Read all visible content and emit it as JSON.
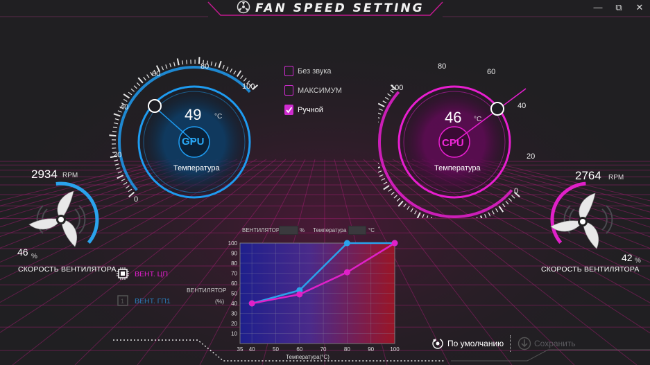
{
  "window": {
    "title": "FAN SPEED SETTING",
    "minimize": "—",
    "maximize": "⧉",
    "close": "✕"
  },
  "gpu": {
    "temp": "49",
    "temp_unit": "°C",
    "name": "GPU",
    "caption": "Температура",
    "ticks": [
      "0",
      "20",
      "40",
      "60",
      "80",
      "100"
    ],
    "temp_value": 49
  },
  "cpu": {
    "temp": "46",
    "temp_unit": "°C",
    "name": "CPU",
    "caption": "Температура",
    "ticks": [
      "0",
      "20",
      "40",
      "60",
      "80",
      "100"
    ],
    "temp_value": 46
  },
  "options": [
    {
      "label": "Без звука",
      "checked": false
    },
    {
      "label": "МАКСИМУМ",
      "checked": false
    },
    {
      "label": "Ручной",
      "checked": true
    }
  ],
  "fan_left": {
    "rpm": "2934",
    "rpm_unit": "RPM",
    "percent": "46",
    "percent_unit": "%",
    "caption": "СКОРОСТЬ ВЕНТИЛЯТОРА",
    "level": 0.46
  },
  "fan_right": {
    "rpm": "2764",
    "rpm_unit": "RPM",
    "percent": "42",
    "percent_unit": "%",
    "caption": "СКОРОСТЬ ВЕНТИЛЯТОРА",
    "level": 0.42
  },
  "selectors": [
    {
      "label": "ВЕНТ. ЦП",
      "active": true
    },
    {
      "label": "ВЕНТ. ГП1",
      "active": false
    }
  ],
  "chart_header": {
    "fan_label": "ВЕНТИЛЯТОР",
    "fan_unit": "%",
    "temp_label": "Температура",
    "temp_unit": "°C"
  },
  "chart_data": {
    "type": "line",
    "ylabel_line1": "ВЕНТИЛЯТОР",
    "ylabel_line2": "(%)",
    "xlabel": "Температура(°C)",
    "x_ticks": [
      "35",
      "40",
      "50",
      "60",
      "70",
      "80",
      "90",
      "100"
    ],
    "y_ticks": [
      "10",
      "20",
      "30",
      "40",
      "50",
      "60",
      "70",
      "80",
      "90",
      "100"
    ],
    "xlim": [
      35,
      100
    ],
    "ylim": [
      0,
      100
    ],
    "series": [
      {
        "color": "#2aa3ec",
        "points": [
          [
            40,
            40
          ],
          [
            60,
            53
          ],
          [
            80,
            100
          ],
          [
            100,
            100
          ]
        ]
      },
      {
        "color": "#e020c8",
        "points": [
          [
            40,
            40
          ],
          [
            60,
            49
          ],
          [
            80,
            71
          ],
          [
            100,
            100
          ]
        ]
      }
    ]
  },
  "actions": {
    "default": "По умолчанию",
    "save": "Сохранить"
  },
  "colors": {
    "gpu": "#1e9bf0",
    "cpu": "#e81ed0",
    "bg": "#201f22"
  }
}
